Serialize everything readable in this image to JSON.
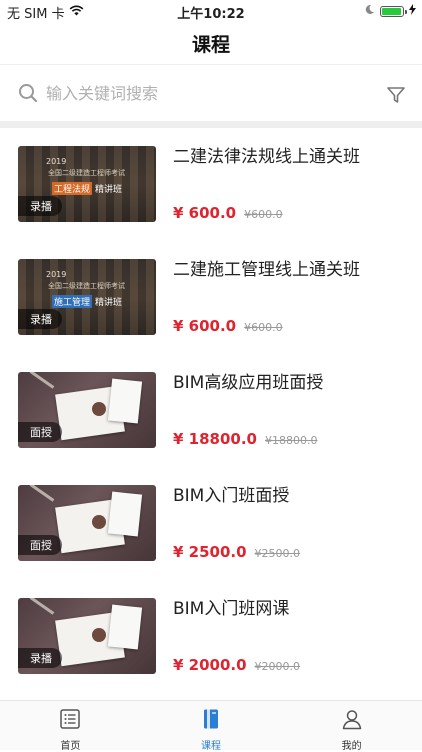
{
  "status_bar": {
    "carrier": "无 SIM 卡",
    "time": "上午10:22",
    "battery_level": 0.95
  },
  "nav": {
    "title": "课程"
  },
  "search": {
    "placeholder": "输入关键词搜索"
  },
  "courses": [
    {
      "title": "二建法律法规线上通关班",
      "price": "¥ 600.0",
      "original_price": "¥600.0",
      "badge": "录播",
      "thumb": {
        "style": "exam",
        "year": "2019",
        "exam": "全国二级建造工程师考试",
        "subject": "工程法规",
        "class_name": "精讲班"
      }
    },
    {
      "title": "二建施工管理线上通关班",
      "price": "¥ 600.0",
      "original_price": "¥600.0",
      "badge": "录播",
      "thumb": {
        "style": "exam",
        "year": "2019",
        "exam": "全国二级建造工程师考试",
        "subject": "施工管理",
        "class_name": "精讲班"
      }
    },
    {
      "title": "BIM高级应用班面授",
      "price": "¥ 18800.0",
      "original_price": "¥18800.0",
      "badge": "面授",
      "thumb": {
        "style": "desk"
      }
    },
    {
      "title": "BIM入门班面授",
      "price": "¥ 2500.0",
      "original_price": "¥2500.0",
      "badge": "面授",
      "thumb": {
        "style": "desk"
      }
    },
    {
      "title": "BIM入门班网课",
      "price": "¥ 2000.0",
      "original_price": "¥2000.0",
      "badge": "录播",
      "thumb": {
        "style": "desk"
      }
    }
  ],
  "tab_bar": {
    "tabs": [
      {
        "label": "首页",
        "icon": "home-list-icon",
        "active": false
      },
      {
        "label": "课程",
        "icon": "book-icon",
        "active": true
      },
      {
        "label": "我的",
        "icon": "user-icon",
        "active": false
      }
    ]
  },
  "colors": {
    "accent": "#2a7fd4",
    "price": "#e0242f"
  }
}
